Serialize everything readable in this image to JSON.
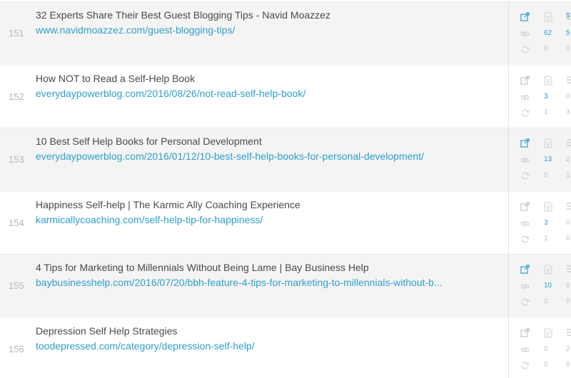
{
  "rows": [
    {
      "number": "151",
      "title": "32 Experts Share Their Best Guest Blogging Tips - Navid Moazzez",
      "url": "www.navidmoazzez.com/guest-blogging-tips/",
      "shaded": true,
      "external_link_active": true,
      "stat_links": "62",
      "stat_links_highlight": true,
      "stat_shares": "0",
      "side_top": "5",
      "side_mid": "5",
      "side_bottom": "0"
    },
    {
      "number": "152",
      "title": "How NOT to Read a Self-Help Book",
      "url": "everydaypowerblog.com/2016/08/26/not-read-self-help-book/",
      "shaded": false,
      "external_link_active": false,
      "stat_links": "3",
      "stat_links_highlight": true,
      "stat_shares": "1",
      "side_top": "",
      "side_mid": "0",
      "side_bottom": "3"
    },
    {
      "number": "153",
      "title": "10 Best Self Help Books for Personal Development",
      "url": "everydaypowerblog.com/2016/01/12/10-best-self-help-books-for-personal-development/",
      "shaded": true,
      "external_link_active": true,
      "stat_links": "13",
      "stat_links_highlight": true,
      "stat_shares": "0",
      "side_top": "",
      "side_mid": "2",
      "side_bottom": "1"
    },
    {
      "number": "154",
      "title": "Happiness Self-help | The Karmic Ally Coaching Experience",
      "url": "karmicallycoaching.com/self-help-tip-for-happiness/",
      "shaded": false,
      "external_link_active": false,
      "stat_links": "3",
      "stat_links_highlight": true,
      "stat_shares": "1",
      "side_top": "",
      "side_mid": "0",
      "side_bottom": "0"
    },
    {
      "number": "155",
      "title": "4 Tips for Marketing to Millennials Without Being Lame | Bay Business Help",
      "url": "baybusinesshelp.com/2016/07/20/bbh-feature-4-tips-for-marketing-to-millennials-without-b...",
      "shaded": true,
      "external_link_active": true,
      "stat_links": "10",
      "stat_links_highlight": true,
      "stat_shares": "0",
      "side_top": "",
      "side_mid": "0",
      "side_bottom": "0"
    },
    {
      "number": "156",
      "title": "Depression Self Help Strategies",
      "url": "toodepressed.com/category/depression-self-help/",
      "shaded": false,
      "external_link_active": false,
      "stat_links": "0",
      "stat_links_highlight": false,
      "stat_shares": "0",
      "side_top": "",
      "side_mid": "2",
      "side_bottom": "0"
    }
  ],
  "icons": {
    "external": "external-link-icon",
    "page": "page-icon",
    "menu": "menu-lines-icon",
    "link": "link-chain-icon",
    "share": "share-arrow-icon"
  },
  "colors": {
    "link": "#2f9fcb",
    "muted": "#c4c4c4",
    "shaded_row": "#f4f4f4"
  }
}
